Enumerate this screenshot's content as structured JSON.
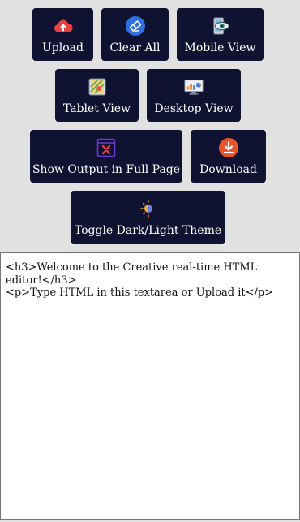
{
  "toolbar": {
    "upload": {
      "label": "Upload",
      "icon": "cloud-upload-icon"
    },
    "clear_all": {
      "label": "Clear All",
      "icon": "eraser-icon"
    },
    "mobile_view": {
      "label": "Mobile View",
      "icon": "phone-eye-icon"
    },
    "tablet_view": {
      "label": "Tablet View",
      "icon": "tablet-map-icon"
    },
    "desktop_view": {
      "label": "Desktop View",
      "icon": "desktop-chart-icon"
    },
    "full_page": {
      "label": "Show Output in Full Page",
      "icon": "fullscreen-window-icon"
    },
    "download": {
      "label": "Download",
      "icon": "download-icon"
    },
    "theme": {
      "label": "Toggle Dark/Light Theme",
      "icon": "sun-moon-icon"
    }
  },
  "editor": {
    "content": "<h3>Welcome to the Creative real-time HTML editor!</h3>\n<p>Type HTML in this textarea or Upload it</p>"
  },
  "colors": {
    "page_background": "#e1e1e1",
    "button_background": "#0f1331",
    "button_text": "#ffffff",
    "upload_icon": "#e8413f",
    "eraser_icon": "#2f6fe0",
    "download_icon": "#e8552a",
    "fullscreen_icon": "#6a3bd1"
  }
}
